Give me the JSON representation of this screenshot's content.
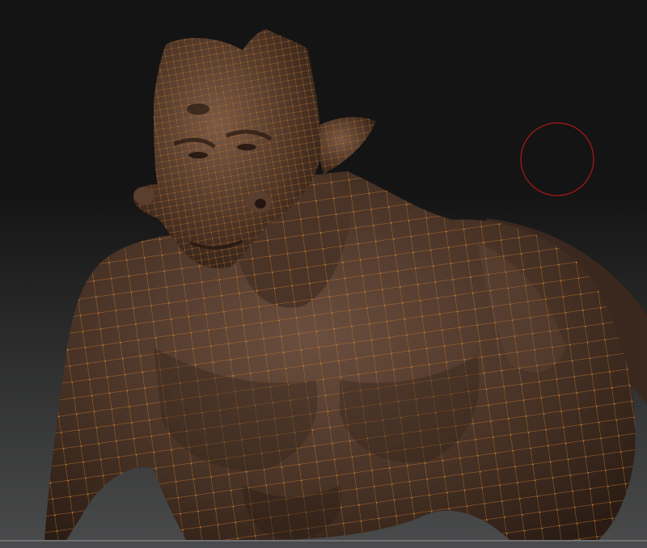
{
  "app": {
    "name": ""
  },
  "canvas": {
    "background_top": "#141414",
    "background_bottom": "#4a4b4c",
    "floor_line": "#7a7b7c"
  },
  "model": {
    "skin_color": "#4a3427",
    "skin_highlight": "#6b4f3f",
    "skin_shadow": "#2a1c14",
    "wire_color": "#c0722a",
    "vertex_color": "#d0853a",
    "head_wire_color": "#b06a2a"
  },
  "brush": {
    "cursor_color": "#b01818",
    "icon": "brush-cursor-icon"
  }
}
